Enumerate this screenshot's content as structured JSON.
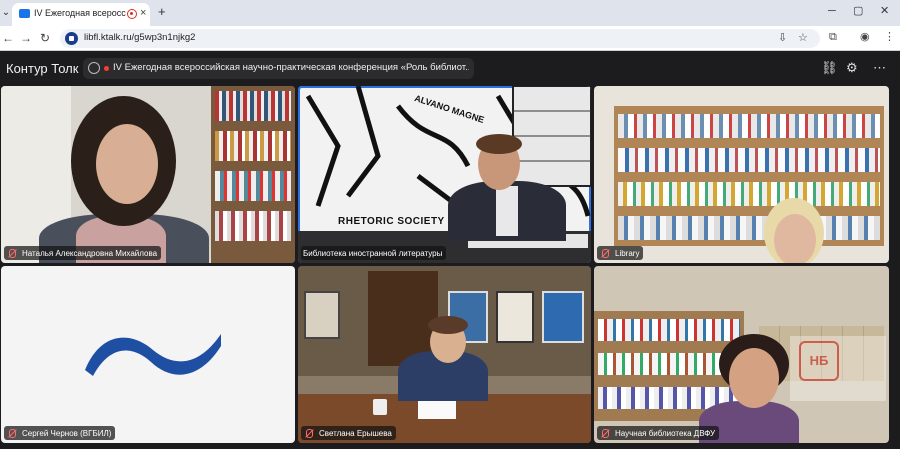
{
  "browser": {
    "tab_title": "IV Ежегодная всероссийск",
    "url": "libfl.ktalk.ru/g5wp3n1njkg2",
    "new_tab_label": "+",
    "close_tab_label": "×",
    "minimize_label": "─",
    "maximize_label": "▢",
    "close_window_label": "✕"
  },
  "app": {
    "brand": "Контур Толк",
    "meeting_title": "IV Ежегодная всероссийская научно-практическая конференция «Роль библиот..."
  },
  "participants": [
    {
      "name": "Наталья Александровна Михайлова",
      "muted": true
    },
    {
      "name": "Библиотека иностранной литературы",
      "muted": false,
      "active_speaker": true
    },
    {
      "name": "Library",
      "muted": true
    },
    {
      "name": "Сергей Чернов (ВГБИЛ)",
      "muted": true
    },
    {
      "name": "Светлана Ерышева",
      "muted": true
    },
    {
      "name": "Научная библиотека ДВФУ",
      "muted": true
    }
  ],
  "backdrop_text": {
    "rhetoric": "RHETORIC SOCIETY",
    "alvano": "ALVANO MAGNE",
    "logo": "НБ"
  },
  "colors": {
    "accent": "#2b6fe0",
    "muted_icon": "#ff6b6b",
    "logo_blue": "#1f4fa3"
  }
}
